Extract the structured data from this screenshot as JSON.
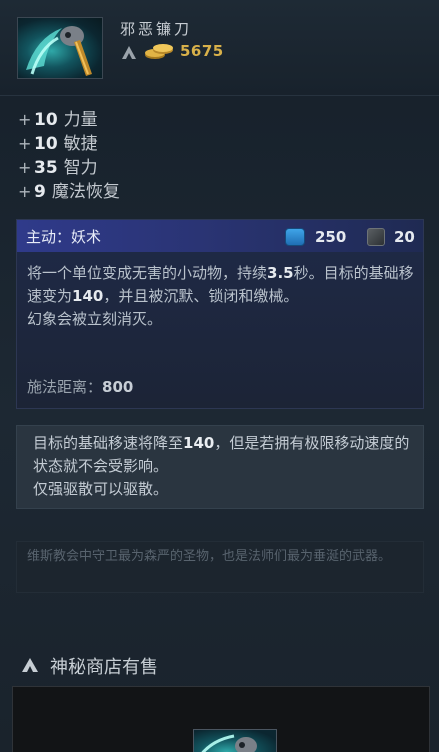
{
  "item": {
    "name": "邪恶镰刀",
    "gold_cost": "5675",
    "icon": "scythe-item-icon"
  },
  "stats": [
    {
      "plus": "+",
      "value": "10",
      "name": "力量"
    },
    {
      "plus": "+",
      "value": "10",
      "name": "敏捷"
    },
    {
      "plus": "+",
      "value": "35",
      "name": "智力"
    },
    {
      "plus": "+",
      "value": "9",
      "name": "魔法恢复"
    }
  ],
  "active": {
    "title": "主动：妖术",
    "mana": "250",
    "cooldown": "20",
    "desc_1a": "将一个单位变成无害的小动物，持续",
    "desc_1b": "3.5",
    "desc_1c": "秒。目标的基础移速变为",
    "desc_1d": "140",
    "desc_1e": "，并且被沉默、锁闭和缴械。",
    "desc_2": "幻象会被立刻消灭。",
    "cast_range_label": "施法距离：",
    "cast_range_value": "800"
  },
  "note": {
    "a": "目标的基础移速将降至",
    "b": "140",
    "c": "，但是若拥有极限移动速度的状态就不会受影响。",
    "d": "仅强驱散可以驱散。"
  },
  "lore": "维斯教会中守卫最为森严的圣物，也是法师们最为垂涎的武器。",
  "shop": {
    "label": "神秘商店有售"
  },
  "colors": {
    "gold": "#d8b14a",
    "mana": "#3fa4e8",
    "active_header": "#2f3a8a"
  }
}
